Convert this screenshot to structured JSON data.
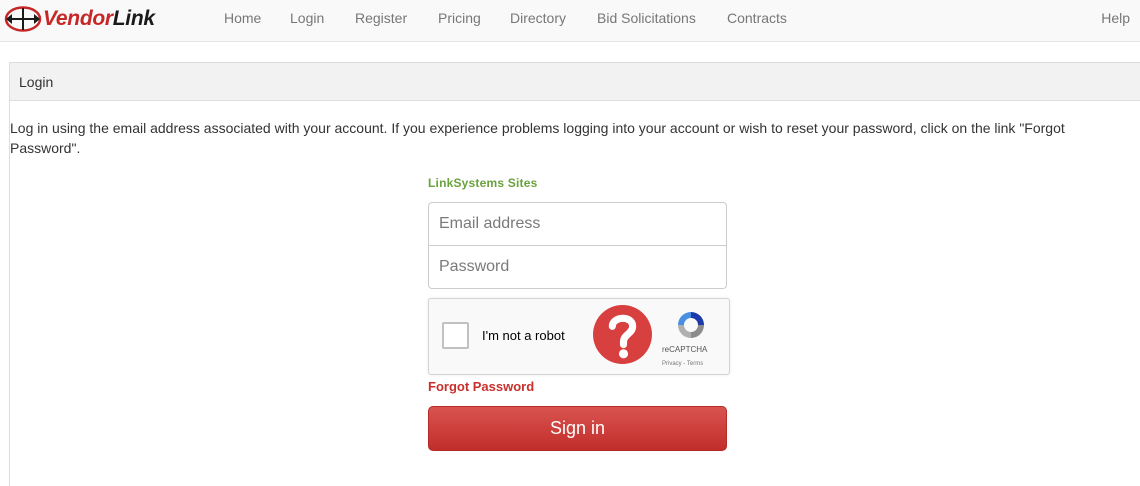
{
  "brand": {
    "name_part1": "Vendor",
    "name_part2": "Link",
    "logo_icon": "globe-arrows-icon"
  },
  "nav": {
    "home": "Home",
    "login": "Login",
    "register": "Register",
    "pricing": "Pricing",
    "directory": "Directory",
    "bid_solicitations": "Bid Solicitations",
    "contracts": "Contracts",
    "help": "Help"
  },
  "panel": {
    "title": "Login",
    "intro": "Log in using the email address associated with your account. If you experience problems logging into your account or wish to reset your password, click on the link \"Forgot Password\"."
  },
  "form": {
    "sites_label": "LinkSystems Sites",
    "email_placeholder": "Email address",
    "email_value": "",
    "password_placeholder": "Password",
    "password_value": "",
    "forgot_label": "Forgot Password",
    "signin_label": "Sign in"
  },
  "captcha": {
    "label": "I'm not a robot",
    "brand": "reCAPTCHA",
    "links": "Privacy - Terms",
    "status_icon": "question-mark-icon"
  },
  "colors": {
    "brand_red": "#c62828",
    "sites_green": "#6aa23c",
    "button_red": "#d9534f",
    "forgot_red": "#c9302c",
    "captcha_warning": "#d8403f"
  }
}
